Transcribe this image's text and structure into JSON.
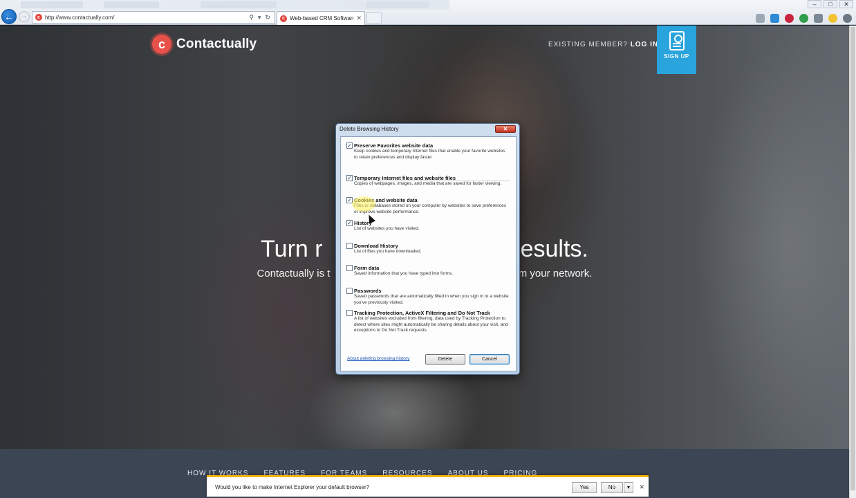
{
  "browser": {
    "url": "http://www.contactually.com/",
    "tab_title": "Web-based CRM Software ...",
    "back_icon": "back-arrow",
    "forward_icon": "forward-arrow",
    "window_controls": [
      "–",
      "□",
      "✕"
    ]
  },
  "page": {
    "logo_text": "Contactually",
    "login_prefix": "EXISTING MEMBER?",
    "login_link": "LOG IN",
    "signup_label": "SIGN UP",
    "hero_title_left": "Turn r",
    "hero_title_right": "esults.",
    "hero_sub_left": "Contactually is t",
    "hero_sub_right": "om your network.",
    "nav": [
      "HOW IT WORKS",
      "FEATURES",
      "FOR TEAMS",
      "RESOURCES",
      "ABOUT US",
      "PRICING"
    ],
    "brand_color": "#e8514a",
    "signup_color": "#2aa4dc"
  },
  "dialog": {
    "title": "Delete Browsing History",
    "options": [
      {
        "label": "Preserve Favorites website data",
        "checked": true,
        "desc": "Keep cookies and temporary Internet files that enable your favorite websites to retain preferences and display faster."
      },
      {
        "label": "Temporary Internet files and website files",
        "checked": true,
        "desc": "Copies of webpages, images, and media that are saved for faster viewing."
      },
      {
        "label": "Cookies and website data",
        "checked": true,
        "desc": "Files or databases stored on your computer by websites to save preferences or improve website performance."
      },
      {
        "label": "History",
        "checked": true,
        "desc": "List of websites you have visited."
      },
      {
        "label": "Download History",
        "checked": false,
        "desc": "List of files you have downloaded."
      },
      {
        "label": "Form data",
        "checked": false,
        "desc": "Saved information that you have typed into forms."
      },
      {
        "label": "Passwords",
        "checked": false,
        "desc": "Saved passwords that are automatically filled in when you sign in to a website you've previously visited."
      },
      {
        "label": "Tracking Protection, ActiveX Filtering and Do Not Track",
        "checked": false,
        "desc": "A list of websites excluded from filtering, data used by Tracking Protection to detect where sites might automatically be sharing details about your visit, and exceptions to Do Not Track requests."
      }
    ],
    "about_link": "About deleting browsing history",
    "delete_label": "Delete",
    "cancel_label": "Cancel"
  },
  "notification": {
    "message": "Would you like to make Internet Explorer your default browser?",
    "yes_label": "Yes",
    "no_label": "No",
    "dropdown": "▾",
    "close": "✕"
  }
}
